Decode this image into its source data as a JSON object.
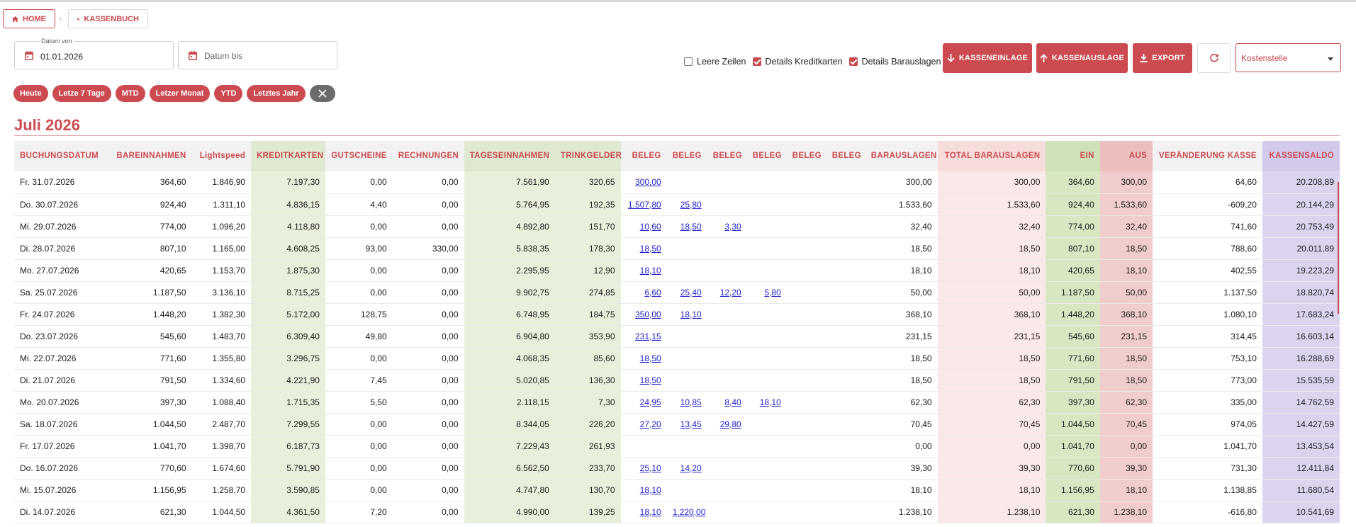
{
  "breadcrumb": {
    "home": "HOME",
    "kassenbuch": "KASSENBUCH"
  },
  "filters": {
    "datum_von_label": "Datum von",
    "datum_von_value": "01.01.2026",
    "datum_bis_placeholder": "Datum bis",
    "leere_zeilen": "Leere Zeilen",
    "details_kreditkarten": "Details Kreditkarten",
    "details_barauslagen": "Details Barauslagen",
    "kostenstelle_placeholder": "Kostenstelle"
  },
  "checkbox_states": {
    "leere_zeilen": false,
    "details_kreditkarten": true,
    "details_barauslagen": true
  },
  "actions": {
    "kasseneinlage": "KASSENEINLAGE",
    "kassenauslage": "KASSENAUSLAGE",
    "export": "EXPORT"
  },
  "chips": [
    "Heute",
    "Letze 7 Tage",
    "MTD",
    "Letzer Monat",
    "YTD",
    "Letztes Jahr"
  ],
  "month_title": "Juli 2026",
  "colors": {
    "accent": "#cc4b50",
    "green": "#e8f0dc",
    "pink": "#fbe9e9",
    "purple": "#dcd4ef",
    "link": "#2222cc"
  },
  "table": {
    "headers": [
      "BUCHUNGSDATUM",
      "BAREINNAHMEN",
      "Lightspeed",
      "KREDITKARTEN",
      "GUTSCHEINE",
      "RECHNUNGEN",
      "TAGESEINNAHMEN",
      "TRINKGELDER",
      "BELEG",
      "BELEG",
      "BELEG",
      "BELEG",
      "BELEG",
      "BELEG",
      "BARAUSLAGEN",
      "TOTAL BARAUSLAGEN",
      "EIN",
      "AUS",
      "VERÄNDERUNG KASSE",
      "KASSENSALDO"
    ],
    "rows": [
      [
        "Fr. 31.07.2026",
        "364,60",
        "1.846,90",
        "7.197,30",
        "0,00",
        "0,00",
        "7.561,90",
        "320,65",
        "300,00",
        "",
        "",
        "",
        "",
        "",
        "300,00",
        "300,00",
        "364,60",
        "300,00",
        "64,60",
        "20.208,89"
      ],
      [
        "Do. 30.07.2026",
        "924,40",
        "1.311,10",
        "4.836,15",
        "4,40",
        "0,00",
        "5.764,95",
        "192,35",
        "1.507,80",
        "25,80",
        "",
        "",
        "",
        "",
        "1.533,60",
        "1.533,60",
        "924,40",
        "1.533,60",
        "-609,20",
        "20.144,29"
      ],
      [
        "Mi. 29.07.2026",
        "774,00",
        "1.096,20",
        "4.118,80",
        "0,00",
        "0,00",
        "4.892,80",
        "151,70",
        "10,60",
        "18,50",
        "3,30",
        "",
        "",
        "",
        "32,40",
        "32,40",
        "774,00",
        "32,40",
        "741,60",
        "20.753,49"
      ],
      [
        "Di. 28.07.2026",
        "807,10",
        "1.165,00",
        "4.608,25",
        "93,00",
        "330,00",
        "5.838,35",
        "178,30",
        "18,50",
        "",
        "",
        "",
        "",
        "",
        "18,50",
        "18,50",
        "807,10",
        "18,50",
        "788,60",
        "20.011,89"
      ],
      [
        "Mo. 27.07.2026",
        "420,65",
        "1.153,70",
        "1.875,30",
        "0,00",
        "0,00",
        "2.295,95",
        "12,90",
        "18,10",
        "",
        "",
        "",
        "",
        "",
        "18,10",
        "18,10",
        "420,65",
        "18,10",
        "402,55",
        "19.223,29"
      ],
      [
        "Sa. 25.07.2026",
        "1.187,50",
        "3.136,10",
        "8.715,25",
        "0,00",
        "0,00",
        "9.902,75",
        "274,85",
        "6,60",
        "25,40",
        "12,20",
        "5,80",
        "",
        "",
        "50,00",
        "50,00",
        "1.187,50",
        "50,00",
        "1.137,50",
        "18.820,74"
      ],
      [
        "Fr. 24.07.2026",
        "1.448,20",
        "1.382,30",
        "5.172,00",
        "128,75",
        "0,00",
        "6.748,95",
        "184,75",
        "350,00",
        "18,10",
        "",
        "",
        "",
        "",
        "368,10",
        "368,10",
        "1.448,20",
        "368,10",
        "1.080,10",
        "17.683,24"
      ],
      [
        "Do. 23.07.2026",
        "545,60",
        "1.483,70",
        "6.309,40",
        "49,80",
        "0,00",
        "6.904,80",
        "353,90",
        "231,15",
        "",
        "",
        "",
        "",
        "",
        "231,15",
        "231,15",
        "545,60",
        "231,15",
        "314,45",
        "16.603,14"
      ],
      [
        "Mi. 22.07.2026",
        "771,60",
        "1.355,80",
        "3.296,75",
        "0,00",
        "0,00",
        "4.068,35",
        "85,60",
        "18,50",
        "",
        "",
        "",
        "",
        "",
        "18,50",
        "18,50",
        "771,60",
        "18,50",
        "753,10",
        "16.288,69"
      ],
      [
        "Di. 21.07.2026",
        "791,50",
        "1.334,60",
        "4.221,90",
        "7,45",
        "0,00",
        "5.020,85",
        "136,30",
        "18,50",
        "",
        "",
        "",
        "",
        "",
        "18,50",
        "18,50",
        "791,50",
        "18,50",
        "773,00",
        "15.535,59"
      ],
      [
        "Mo. 20.07.2026",
        "397,30",
        "1.088,40",
        "1.715,35",
        "5,50",
        "0,00",
        "2.118,15",
        "7,30",
        "24,95",
        "10,85",
        "8,40",
        "18,10",
        "",
        "",
        "62,30",
        "62,30",
        "397,30",
        "62,30",
        "335,00",
        "14.762,59"
      ],
      [
        "Sa. 18.07.2026",
        "1.044,50",
        "2.487,70",
        "7.299,55",
        "0,00",
        "0,00",
        "8.344,05",
        "226,20",
        "27,20",
        "13,45",
        "29,80",
        "",
        "",
        "",
        "70,45",
        "70,45",
        "1.044,50",
        "70,45",
        "974,05",
        "14.427,59"
      ],
      [
        "Fr. 17.07.2026",
        "1.041,70",
        "1.398,70",
        "6.187,73",
        "0,00",
        "0,00",
        "7.229,43",
        "261,93",
        "",
        "",
        "",
        "",
        "",
        "",
        "0,00",
        "0,00",
        "1.041,70",
        "0,00",
        "1.041,70",
        "13.453,54"
      ],
      [
        "Do. 16.07.2026",
        "770,60",
        "1.674,60",
        "5.791,90",
        "0,00",
        "0,00",
        "6.562,50",
        "233,70",
        "25,10",
        "14,20",
        "",
        "",
        "",
        "",
        "39,30",
        "39,30",
        "770,60",
        "39,30",
        "731,30",
        "12.411,84"
      ],
      [
        "Mi. 15.07.2026",
        "1.156,95",
        "1.258,70",
        "3.590,85",
        "0,00",
        "0,00",
        "4.747,80",
        "130,70",
        "18,10",
        "",
        "",
        "",
        "",
        "",
        "18,10",
        "18,10",
        "1.156,95",
        "18,10",
        "1.138,85",
        "11.680,54"
      ],
      [
        "Di. 14.07.2026",
        "621,30",
        "1.044,50",
        "4.361,50",
        "7,20",
        "0,00",
        "4.990,00",
        "139,25",
        "18,10",
        "1.220,00",
        "",
        "",
        "",
        "",
        "1.238,10",
        "1.238,10",
        "621,30",
        "1.238,10",
        "-616,80",
        "10.541,69"
      ]
    ]
  }
}
